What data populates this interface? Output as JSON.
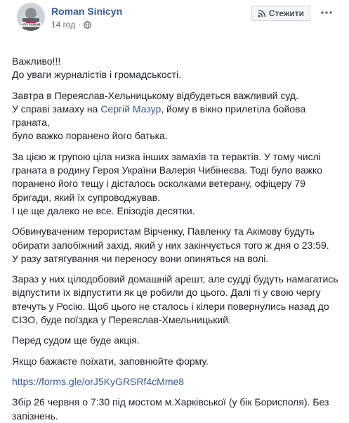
{
  "header": {
    "author_name": "Roman Sinicyn",
    "time": "14 год",
    "separator": "·",
    "follow_label": "Стежити",
    "avatar_caption": "ЧТО ЗАМОВ"
  },
  "post": {
    "p1_line1": "Важливо!!!",
    "p1_line2": "До уваги журналістів і громадськості.",
    "p2_pre": "Завтра в Переяслав-Хельницькому відбудеться важливий суд.",
    "p2_line2_pre": "У справі замаху на ",
    "p2_mention": "Сергій Мазур",
    "p2_line2_post": ", йому в вікно прилетіла бойова граната,",
    "p2_line3": "було важко поранено його батька.",
    "p3_line1": "За цією ж групою ціла низка інших замахів та терактів. У тому числі",
    "p3_line2": "граната в родину Героя України Валерія Чибінеєва. Тоді було важко",
    "p3_line3": "поранено його тещу і дісталось осколками ветерану, офіцеру 79",
    "p3_line4": "бригади, який їх супроводжував.",
    "p3_line5": "І це ще далеко не все. Епізодів десятки.",
    "p4_line1": "Обвинуваченим терористам Вірченку, Павленку та Акімову будуть",
    "p4_line2": "обирати запобіжний захід, який у них закінчується того ж дня о 23:59.",
    "p4_line3": "У разу затягування чи переносу вони опиняться на волі.",
    "p5_line1": "Зараз у них цілодобовий домашній арешт, але судді будуть намагатись",
    "p5_line2": "відпустити їх відпустити як це робили до цього. Далі ті у свою чергу",
    "p5_line3": "втечуть у Росію. Щоб цього не сталось і кілери повернулись назад до",
    "p5_line4": "СІЗО, буде поїздка у Переяслав-Хмельницький.",
    "p6": "Перед судом ще буде акція.",
    "p7": "Якщо бажаєте поїхати, заповнюйте форму.",
    "p8_link": "https://forms.gle/orJ5KyGRSRf4cMme8",
    "p9_line1": "Збір 26 червня о 7:30 під мостом м.Харківської (у бік Борисполя). Без",
    "p9_line2": "запізнень."
  },
  "icons": {
    "globe": "globe-icon",
    "rss": "rss-icon",
    "more": "more-horizontal-icon"
  },
  "colors": {
    "link": "#385898",
    "text": "#1d2129",
    "meta": "#616770"
  }
}
